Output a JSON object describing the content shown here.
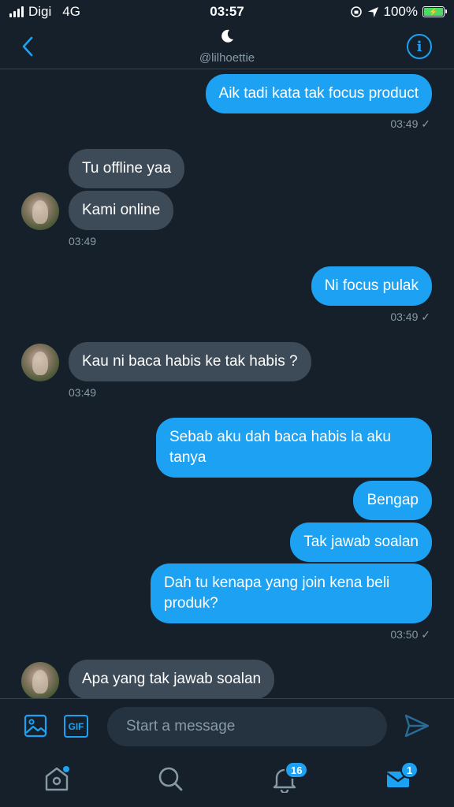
{
  "status_bar": {
    "carrier": "Digi",
    "network": "4G",
    "time": "03:57",
    "battery": "100%"
  },
  "header": {
    "handle": "@lilhoettie",
    "icon": "moon-icon"
  },
  "messages": [
    {
      "dir": "sent",
      "text": "Aik tadi kata tak focus product"
    },
    {
      "timestamp": "03:49 ✓"
    },
    {
      "dir": "recv",
      "text": "Tu offline yaa"
    },
    {
      "dir": "recv",
      "text": "Kami online"
    },
    {
      "timestamp": "03:49"
    },
    {
      "dir": "sent",
      "text": "Ni focus pulak"
    },
    {
      "timestamp": "03:49 ✓"
    },
    {
      "dir": "recv",
      "text": "Kau ni baca habis ke tak habis ?"
    },
    {
      "timestamp": "03:49"
    },
    {
      "dir": "sent",
      "text": "Sebab aku dah baca habis la aku tanya"
    },
    {
      "dir": "sent",
      "text": "Bengap"
    },
    {
      "dir": "sent",
      "text": "Tak jawab soalan"
    },
    {
      "dir": "sent",
      "text": "Dah tu kenapa yang join kena beli produk?"
    },
    {
      "timestamp": "03:50 ✓"
    },
    {
      "dir": "recv",
      "text": "Apa yang tak jawab soalan"
    }
  ],
  "composer": {
    "placeholder": "Start a message",
    "gif_label": "GIF"
  },
  "tabbar": {
    "notifications_badge": "16",
    "messages_badge": "1"
  },
  "colors": {
    "background": "#15202b",
    "accent": "#1da1f2",
    "received_bubble": "#3d4a57",
    "muted_text": "#8899a6"
  }
}
